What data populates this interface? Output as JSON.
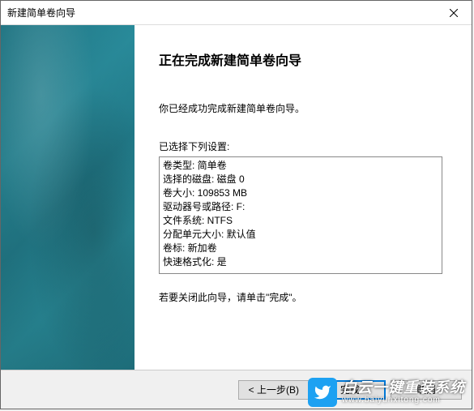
{
  "window": {
    "title": "新建简单卷向导"
  },
  "main": {
    "heading": "正在完成新建简单卷向导",
    "intro": "你已经成功完成新建简单卷向导。",
    "settings_label": "已选择下列设置:",
    "settings": [
      "卷类型: 简单卷",
      "选择的磁盘: 磁盘 0",
      "卷大小: 109853 MB",
      "驱动器号或路径: F:",
      "文件系统: NTFS",
      "分配单元大小: 默认值",
      "卷标: 新加卷",
      "快速格式化: 是"
    ],
    "closing": "若要关闭此向导，请单击\"完成\"。"
  },
  "buttons": {
    "back": "< 上一步(B)",
    "finish": "完成",
    "cancel": "取消"
  },
  "watermark": {
    "main": "白云一键重装系统",
    "sub": "www.baiyunxitong.com"
  }
}
